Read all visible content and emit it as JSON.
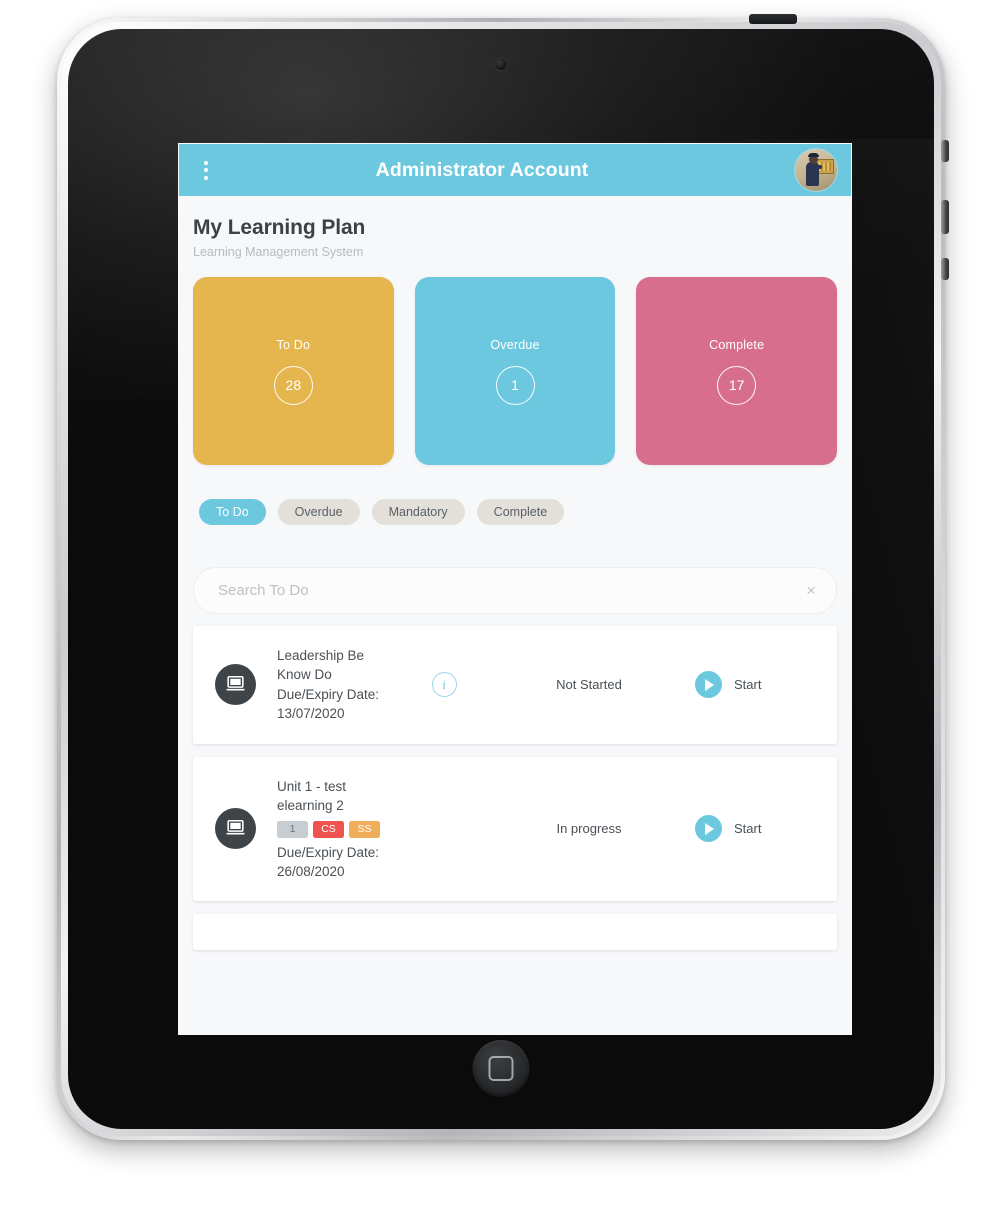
{
  "device": {
    "name": "tablet",
    "home_button": "home-button",
    "camera": "front-camera"
  },
  "app_bar": {
    "menu_icon": "overflow-menu-icon",
    "title": "Administrator Account",
    "avatar": "user-avatar",
    "background_color": "#6CC8DF",
    "text_color": "#FFFFFF"
  },
  "heading": {
    "title": "My Learning Plan",
    "subtitle": "Learning Management System"
  },
  "stat_cards": [
    {
      "label": "To Do",
      "count": "28",
      "color": "#E5B54E"
    },
    {
      "label": "Overdue",
      "count": "1",
      "color": "#6CC8DF"
    },
    {
      "label": "Complete",
      "count": "17",
      "color": "#D76E8D"
    }
  ],
  "filters": [
    {
      "label": "To Do",
      "active": true
    },
    {
      "label": "Overdue",
      "active": false
    },
    {
      "label": "Mandatory",
      "active": false
    },
    {
      "label": "Complete",
      "active": false
    }
  ],
  "search": {
    "value": "",
    "placeholder": "Search To Do",
    "clear_icon": "×"
  },
  "courses": [
    {
      "icon": "laptop-icon",
      "title": "Leadership Be\nKnow Do",
      "title_line1": "Leadership Be",
      "title_line2": "Know Do",
      "badges": [],
      "due_label": "Due/Expiry Date:",
      "due_date": "13/07/2020",
      "has_info": true,
      "info_icon": "info-icon",
      "status": "Not Started",
      "action_icon": "play-icon",
      "action_label": "Start"
    },
    {
      "icon": "laptop-icon",
      "title": "Unit 1 - test\nelearning 2",
      "title_line1": "Unit 1 - test",
      "title_line2": "elearning 2",
      "badges": [
        {
          "text": "1",
          "color": "#C8CDD1",
          "text_color": "#6d7479"
        },
        {
          "text": "CS",
          "color": "#EF5350",
          "text_color": "#ffffff"
        },
        {
          "text": "SS",
          "color": "#F0AD5A",
          "text_color": "#ffffff"
        }
      ],
      "due_label": "Due/Expiry Date:",
      "due_date": "26/08/2020",
      "has_info": false,
      "status": "In progress",
      "action_icon": "play-icon",
      "action_label": "Start"
    }
  ],
  "colors": {
    "accent": "#6CC8DF",
    "background": "#F7F8FA",
    "card": "#FFFFFF",
    "chip_inactive": "#E3E0DA",
    "icon_circle": "#3F4448"
  }
}
